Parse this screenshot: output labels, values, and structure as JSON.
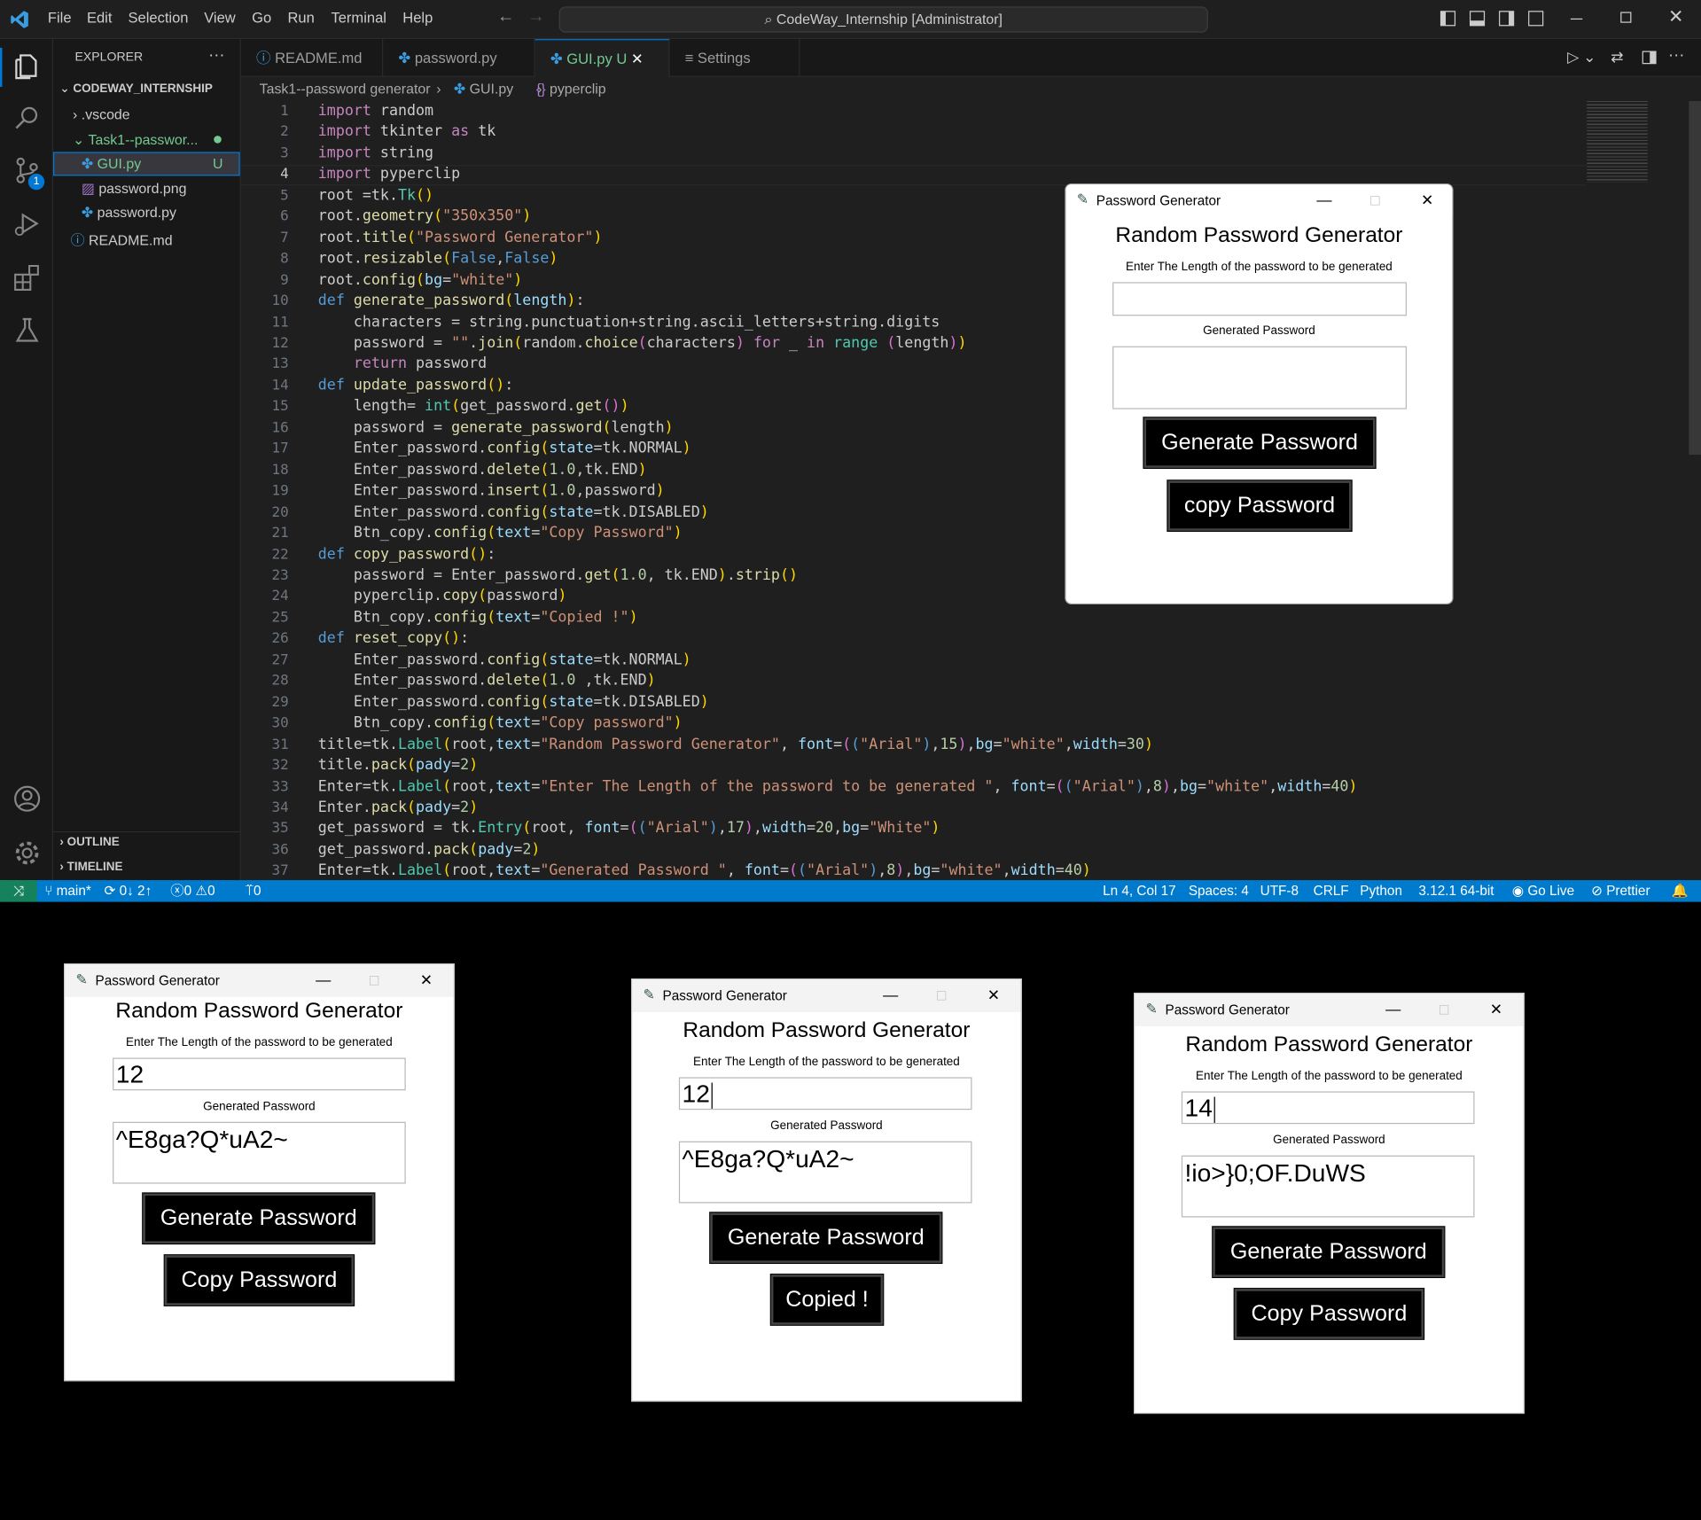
{
  "menu": {
    "items": [
      "File",
      "Edit",
      "Selection",
      "View",
      "Go",
      "Run",
      "Terminal",
      "Help"
    ],
    "search": "CodeWay_Internship [Administrator]"
  },
  "explorer": {
    "header": "EXPLORER",
    "root": "CODEWAY_INTERNSHIP",
    "vscode": ".vscode",
    "task": "Task1--passwor...",
    "gui": "GUI.py",
    "gui_badge": "U",
    "png": "password.png",
    "pwpy": "password.py",
    "readme": "README.md",
    "outline": "OUTLINE",
    "timeline": "TIMELINE",
    "badge": "1"
  },
  "tabs": {
    "t1": "README.md",
    "t2": "password.py",
    "t3": "GUI.py",
    "t3_badge": "U",
    "t4": "Settings"
  },
  "breadcrumb": {
    "b1": "Task1--password generator",
    "b2": "GUI.py",
    "b3": "pyperclip"
  },
  "status": {
    "branch": "main*",
    "sync": "0↓ 2↑",
    "problems": "0",
    "warnings": "0",
    "ports": "0",
    "cursor": "Ln 4, Col 17",
    "spaces": "Spaces: 4",
    "enc": "UTF-8",
    "eol": "CRLF",
    "lang": "Python",
    "ver": "3.12.1 64-bit",
    "golive": "Go Live",
    "prettier": "Prettier"
  },
  "app": {
    "wtitle": "Password Generator",
    "heading": "Random Password Generator",
    "len_label": "Enter The Length of the password to be generated",
    "gen_label": "Generated Password",
    "gen_btn": "Generate Password"
  },
  "win0": {
    "len": "",
    "pw": "",
    "copy": "copy Password"
  },
  "win1": {
    "len": "12",
    "pw": "^E8ga?Q*uA2~",
    "copy": "Copy Password"
  },
  "win2": {
    "len": "12",
    "pw": "^E8ga?Q*uA2~",
    "copy": "Copied !"
  },
  "win3": {
    "len": "14",
    "pw": "!io>}0;OF.DuWS",
    "copy": "Copy Password"
  },
  "colors": {
    "accent": "#007acc",
    "editor_bg": "#1f1f1f",
    "sidebar_bg": "#181818"
  }
}
